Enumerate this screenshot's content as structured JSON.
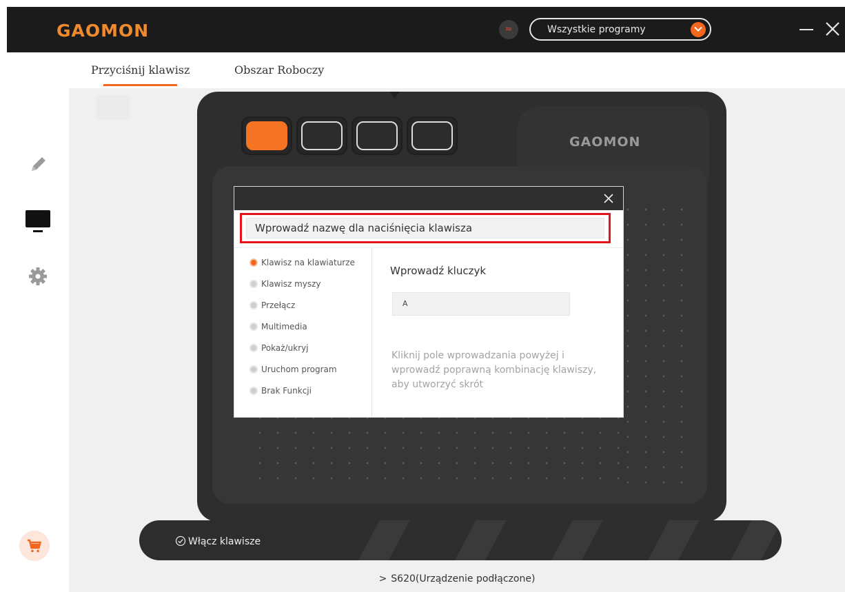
{
  "app": {
    "logo": "GAOMON",
    "program_select": "Wszystkie programy"
  },
  "tabs": [
    {
      "label": "Przyciśnij klawisz",
      "active": true
    },
    {
      "label": "Obszar Roboczy",
      "active": false
    }
  ],
  "sidebar": {
    "items": [
      {
        "icon": "pen-icon"
      },
      {
        "icon": "monitor-icon",
        "active": true
      },
      {
        "icon": "gear-icon"
      },
      {
        "icon": "cart-icon"
      }
    ]
  },
  "tablet": {
    "brand": "GAOMON",
    "express_keys": [
      {
        "active": true
      },
      {
        "active": false
      },
      {
        "active": false
      },
      {
        "active": false
      }
    ]
  },
  "dialog": {
    "name_placeholder": "Wprowadź nazwę dla naciśnięcia klawisza",
    "function_types": [
      {
        "label": "Klawisz na klawiaturze",
        "checked": true
      },
      {
        "label": "Klawisz myszy",
        "checked": false
      },
      {
        "label": "Przełącz",
        "checked": false
      },
      {
        "label": "Multimedia",
        "checked": false
      },
      {
        "label": "Pokaż/ukryj",
        "checked": false
      },
      {
        "label": "Uruchom program",
        "checked": false
      },
      {
        "label": "Brak Funkcji",
        "checked": false
      }
    ],
    "key_heading": "Wprowadź kluczyk",
    "key_value": "A",
    "hint": "Kliknij pole wprowadzania powyżej i wprowadź poprawną kombinację klawiszy, aby utworzyć skrót"
  },
  "footer": {
    "enable_keys": "Włącz klawisze",
    "device_status": "S620(Urządzenie podłączone)"
  },
  "colors": {
    "accent": "#f2661f",
    "highlight": "#e3141c",
    "titlebar": "#1b1b1b"
  }
}
